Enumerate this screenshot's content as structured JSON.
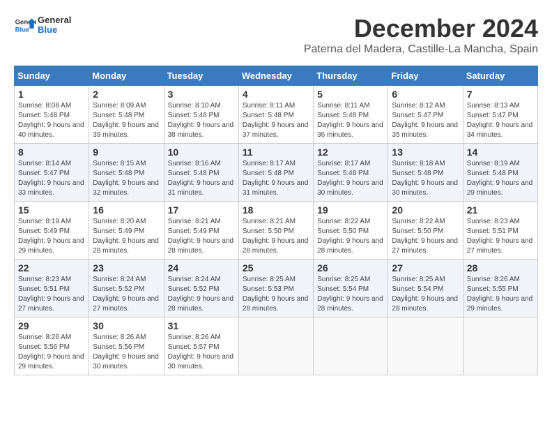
{
  "header": {
    "logo_general": "General",
    "logo_blue": "Blue",
    "month_title": "December 2024",
    "location": "Paterna del Madera, Castille-La Mancha, Spain"
  },
  "weekdays": [
    "Sunday",
    "Monday",
    "Tuesday",
    "Wednesday",
    "Thursday",
    "Friday",
    "Saturday"
  ],
  "weeks": [
    [
      {
        "day": "1",
        "sunrise": "8:08 AM",
        "sunset": "5:48 PM",
        "daylight": "9 hours and 40 minutes."
      },
      {
        "day": "2",
        "sunrise": "8:09 AM",
        "sunset": "5:48 PM",
        "daylight": "9 hours and 39 minutes."
      },
      {
        "day": "3",
        "sunrise": "8:10 AM",
        "sunset": "5:48 PM",
        "daylight": "9 hours and 38 minutes."
      },
      {
        "day": "4",
        "sunrise": "8:11 AM",
        "sunset": "5:48 PM",
        "daylight": "9 hours and 37 minutes."
      },
      {
        "day": "5",
        "sunrise": "8:11 AM",
        "sunset": "5:48 PM",
        "daylight": "9 hours and 36 minutes."
      },
      {
        "day": "6",
        "sunrise": "8:12 AM",
        "sunset": "5:47 PM",
        "daylight": "9 hours and 35 minutes."
      },
      {
        "day": "7",
        "sunrise": "8:13 AM",
        "sunset": "5:47 PM",
        "daylight": "9 hours and 34 minutes."
      }
    ],
    [
      {
        "day": "8",
        "sunrise": "8:14 AM",
        "sunset": "5:47 PM",
        "daylight": "9 hours and 33 minutes."
      },
      {
        "day": "9",
        "sunrise": "8:15 AM",
        "sunset": "5:48 PM",
        "daylight": "9 hours and 32 minutes."
      },
      {
        "day": "10",
        "sunrise": "8:16 AM",
        "sunset": "5:48 PM",
        "daylight": "9 hours and 31 minutes."
      },
      {
        "day": "11",
        "sunrise": "8:17 AM",
        "sunset": "5:48 PM",
        "daylight": "9 hours and 31 minutes."
      },
      {
        "day": "12",
        "sunrise": "8:17 AM",
        "sunset": "5:48 PM",
        "daylight": "9 hours and 30 minutes."
      },
      {
        "day": "13",
        "sunrise": "8:18 AM",
        "sunset": "5:48 PM",
        "daylight": "9 hours and 30 minutes."
      },
      {
        "day": "14",
        "sunrise": "8:19 AM",
        "sunset": "5:48 PM",
        "daylight": "9 hours and 29 minutes."
      }
    ],
    [
      {
        "day": "15",
        "sunrise": "8:19 AM",
        "sunset": "5:49 PM",
        "daylight": "9 hours and 29 minutes."
      },
      {
        "day": "16",
        "sunrise": "8:20 AM",
        "sunset": "5:49 PM",
        "daylight": "9 hours and 28 minutes."
      },
      {
        "day": "17",
        "sunrise": "8:21 AM",
        "sunset": "5:49 PM",
        "daylight": "9 hours and 28 minutes."
      },
      {
        "day": "18",
        "sunrise": "8:21 AM",
        "sunset": "5:50 PM",
        "daylight": "9 hours and 28 minutes."
      },
      {
        "day": "19",
        "sunrise": "8:22 AM",
        "sunset": "5:50 PM",
        "daylight": "9 hours and 28 minutes."
      },
      {
        "day": "20",
        "sunrise": "8:22 AM",
        "sunset": "5:50 PM",
        "daylight": "9 hours and 27 minutes."
      },
      {
        "day": "21",
        "sunrise": "8:23 AM",
        "sunset": "5:51 PM",
        "daylight": "9 hours and 27 minutes."
      }
    ],
    [
      {
        "day": "22",
        "sunrise": "8:23 AM",
        "sunset": "5:51 PM",
        "daylight": "9 hours and 27 minutes."
      },
      {
        "day": "23",
        "sunrise": "8:24 AM",
        "sunset": "5:52 PM",
        "daylight": "9 hours and 27 minutes."
      },
      {
        "day": "24",
        "sunrise": "8:24 AM",
        "sunset": "5:52 PM",
        "daylight": "9 hours and 28 minutes."
      },
      {
        "day": "25",
        "sunrise": "8:25 AM",
        "sunset": "5:53 PM",
        "daylight": "9 hours and 28 minutes."
      },
      {
        "day": "26",
        "sunrise": "8:25 AM",
        "sunset": "5:54 PM",
        "daylight": "9 hours and 28 minutes."
      },
      {
        "day": "27",
        "sunrise": "8:25 AM",
        "sunset": "5:54 PM",
        "daylight": "9 hours and 28 minutes."
      },
      {
        "day": "28",
        "sunrise": "8:26 AM",
        "sunset": "5:55 PM",
        "daylight": "9 hours and 29 minutes."
      }
    ],
    [
      {
        "day": "29",
        "sunrise": "8:26 AM",
        "sunset": "5:56 PM",
        "daylight": "9 hours and 29 minutes."
      },
      {
        "day": "30",
        "sunrise": "8:26 AM",
        "sunset": "5:56 PM",
        "daylight": "9 hours and 30 minutes."
      },
      {
        "day": "31",
        "sunrise": "8:26 AM",
        "sunset": "5:57 PM",
        "daylight": "9 hours and 30 minutes."
      },
      null,
      null,
      null,
      null
    ]
  ]
}
